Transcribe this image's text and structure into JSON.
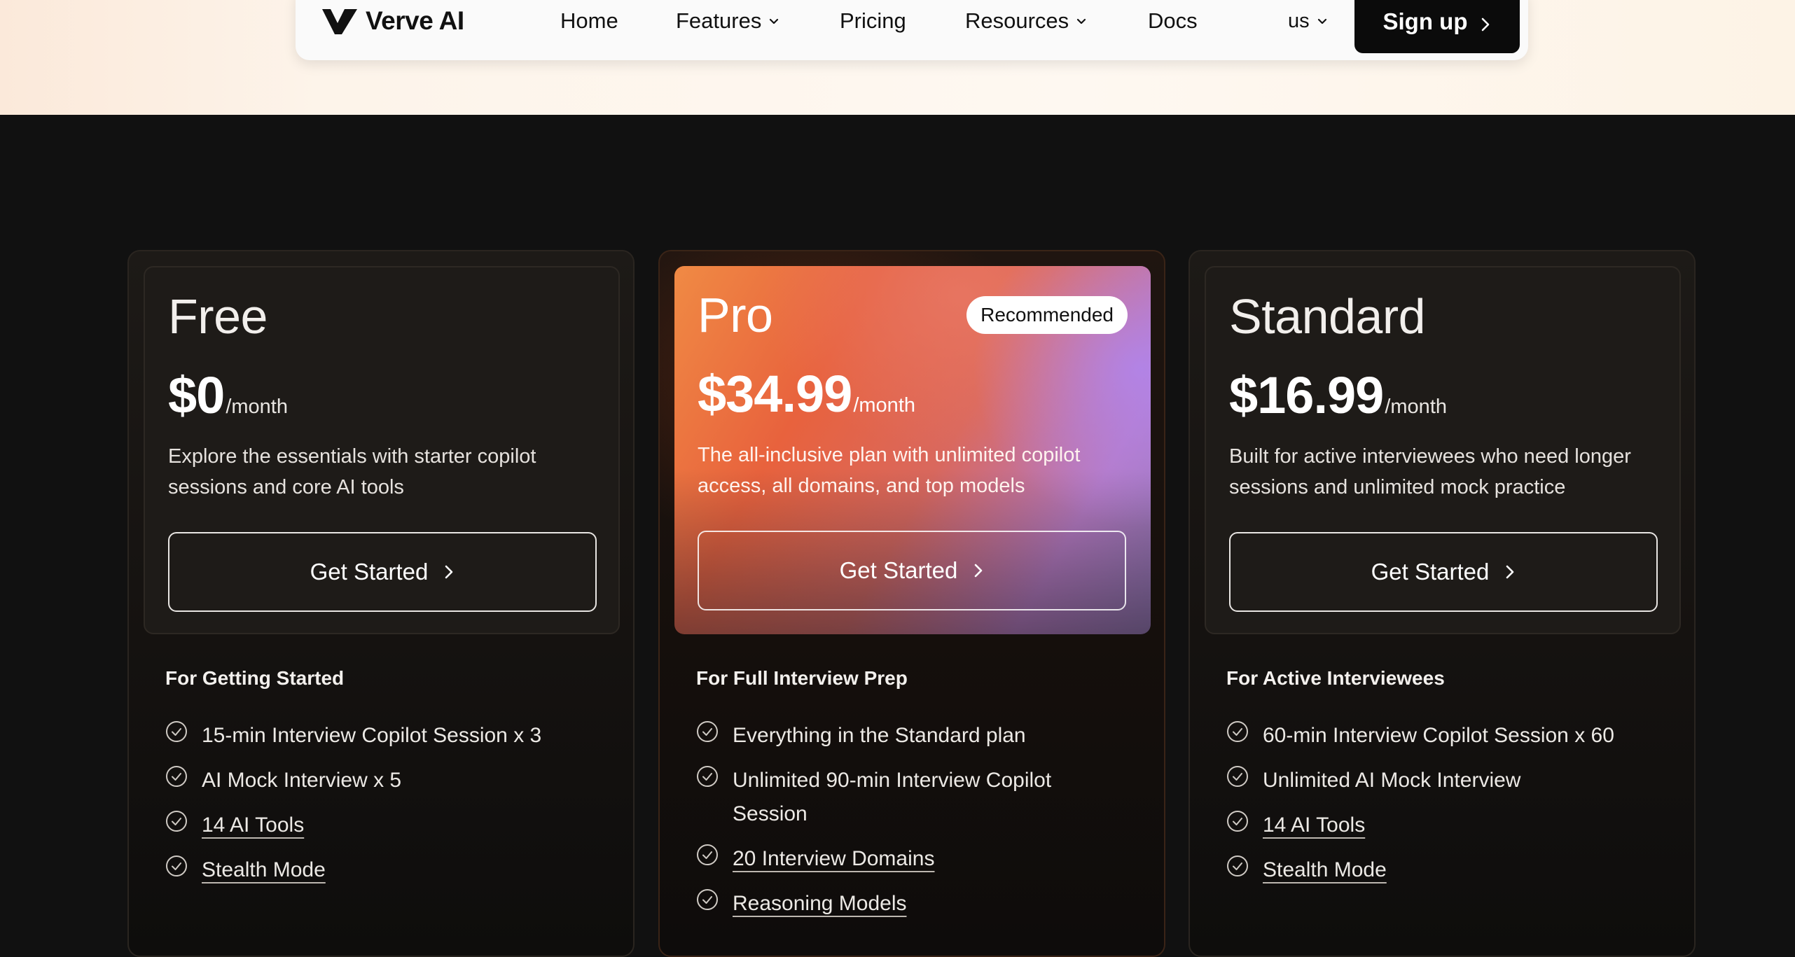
{
  "nav": {
    "logo_text": "Verve AI",
    "items": [
      {
        "label": "Home"
      },
      {
        "label": "Features"
      },
      {
        "label": "Pricing"
      },
      {
        "label": "Resources"
      },
      {
        "label": "Docs"
      }
    ],
    "language": "us",
    "signup_label": "Sign up"
  },
  "icons": {
    "logo": "verve-logo-icon",
    "dropdown": "chevron-down-icon",
    "arrow": "chevron-right-icon",
    "check": "check-circle-icon"
  },
  "colors": {
    "page_bg": "#111111",
    "top_band": "#fdf4ea",
    "signup_bg": "#0b0b0b",
    "pro_gradient_start": "#f08a44",
    "pro_gradient_end": "#b57ac4"
  },
  "plans": [
    {
      "name": "Free",
      "price": "$0",
      "period": "/month",
      "description": "Explore the essentials with starter copilot sessions and core AI tools",
      "cta": "Get Started",
      "section_title": "For Getting Started",
      "features": [
        {
          "text": "15-min Interview Copilot Session x 3",
          "link": false
        },
        {
          "text": "AI Mock Interview x 5",
          "link": false
        },
        {
          "text": "14 AI Tools",
          "link": true
        },
        {
          "text": "Stealth Mode",
          "link": true
        }
      ]
    },
    {
      "name": "Pro",
      "badge": "Recommended",
      "price": "$34.99",
      "period": "/month",
      "description": "The all-inclusive plan with unlimited copilot access, all domains, and top models",
      "cta": "Get Started",
      "section_title": "For Full Interview Prep",
      "features": [
        {
          "text": "Everything in the Standard plan",
          "link": false
        },
        {
          "text": "Unlimited 90-min Interview Copilot Session",
          "link": false
        },
        {
          "text": "20 Interview Domains",
          "link": true
        },
        {
          "text": "Reasoning Models",
          "link": true
        }
      ]
    },
    {
      "name": "Standard",
      "price": "$16.99",
      "period": "/month",
      "description": "Built for active interviewees who need longer sessions and unlimited mock practice",
      "cta": "Get Started",
      "section_title": "For Active Interviewees",
      "features": [
        {
          "text": "60-min Interview Copilot Session x 60",
          "link": false
        },
        {
          "text": "Unlimited AI Mock Interview",
          "link": false
        },
        {
          "text": "14 AI Tools",
          "link": true
        },
        {
          "text": "Stealth Mode",
          "link": true
        }
      ]
    }
  ]
}
